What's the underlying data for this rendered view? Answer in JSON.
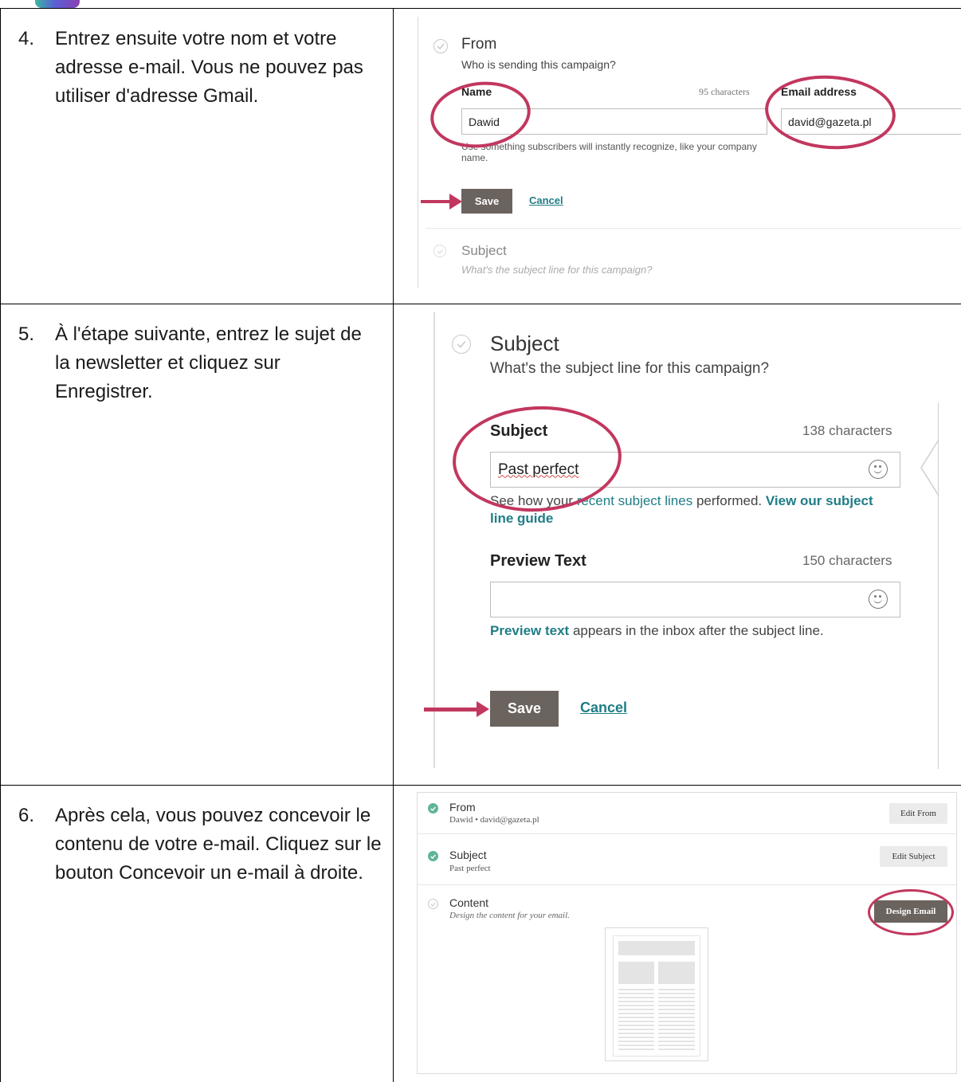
{
  "rows": [
    {
      "number": "4.",
      "instruction": "Entrez ensuite votre nom et votre adresse e-mail. Vous ne pouvez pas utiliser d'adresse Gmail.",
      "from": {
        "title": "From",
        "subtitle": "Who is sending this campaign?",
        "name_label": "Name",
        "name_counter": "95 characters",
        "name_value": "Dawid",
        "email_label": "Email address",
        "email_value": "david@gazeta.pl",
        "help_text": "Use something subscribers will instantly recognize, like your company name.",
        "save_label": "Save",
        "cancel_label": "Cancel"
      },
      "next_section": {
        "title": "Subject",
        "subtitle": "What's the subject line for this campaign?"
      }
    },
    {
      "number": "5.",
      "instruction": "À l'étape suivante, entrez le sujet de la newsletter et cliquez sur Enregistrer.",
      "subject": {
        "title": "Subject",
        "subtitle": "What's the subject line for this campaign?",
        "field_label": "Subject",
        "field_counter": "138 characters",
        "field_value": "Past perfect",
        "help_prefix": "See how your ",
        "help_link1": "recent subject lines",
        "help_middle": " performed. ",
        "help_link2_line1": "View our subject",
        "help_link2_line2": "line guide",
        "preview_label": "Preview Text",
        "preview_counter": "150 characters",
        "preview_value": "",
        "preview_help_link": "Preview text",
        "preview_help_rest": " appears in the inbox after the subject line.",
        "save_label": "Save",
        "cancel_label": "Cancel"
      }
    },
    {
      "number": "6.",
      "instruction": "Après cela, vous pouvez concevoir le contenu de votre e-mail. Cliquez sur le bouton Concevoir un e-mail à droite.",
      "summary": {
        "from_title": "From",
        "from_detail": "Dawid • david@gazeta.pl",
        "edit_from": "Edit From",
        "subject_title": "Subject",
        "subject_detail": "Past perfect",
        "edit_subject": "Edit Subject",
        "content_title": "Content",
        "content_detail": "Design the content for your email.",
        "design_email": "Design Email"
      }
    }
  ],
  "colors": {
    "annotation": "#c2375e",
    "button_dark": "#6b635e",
    "link_teal": "#1f7d86",
    "check_green": "#5fb49a"
  }
}
